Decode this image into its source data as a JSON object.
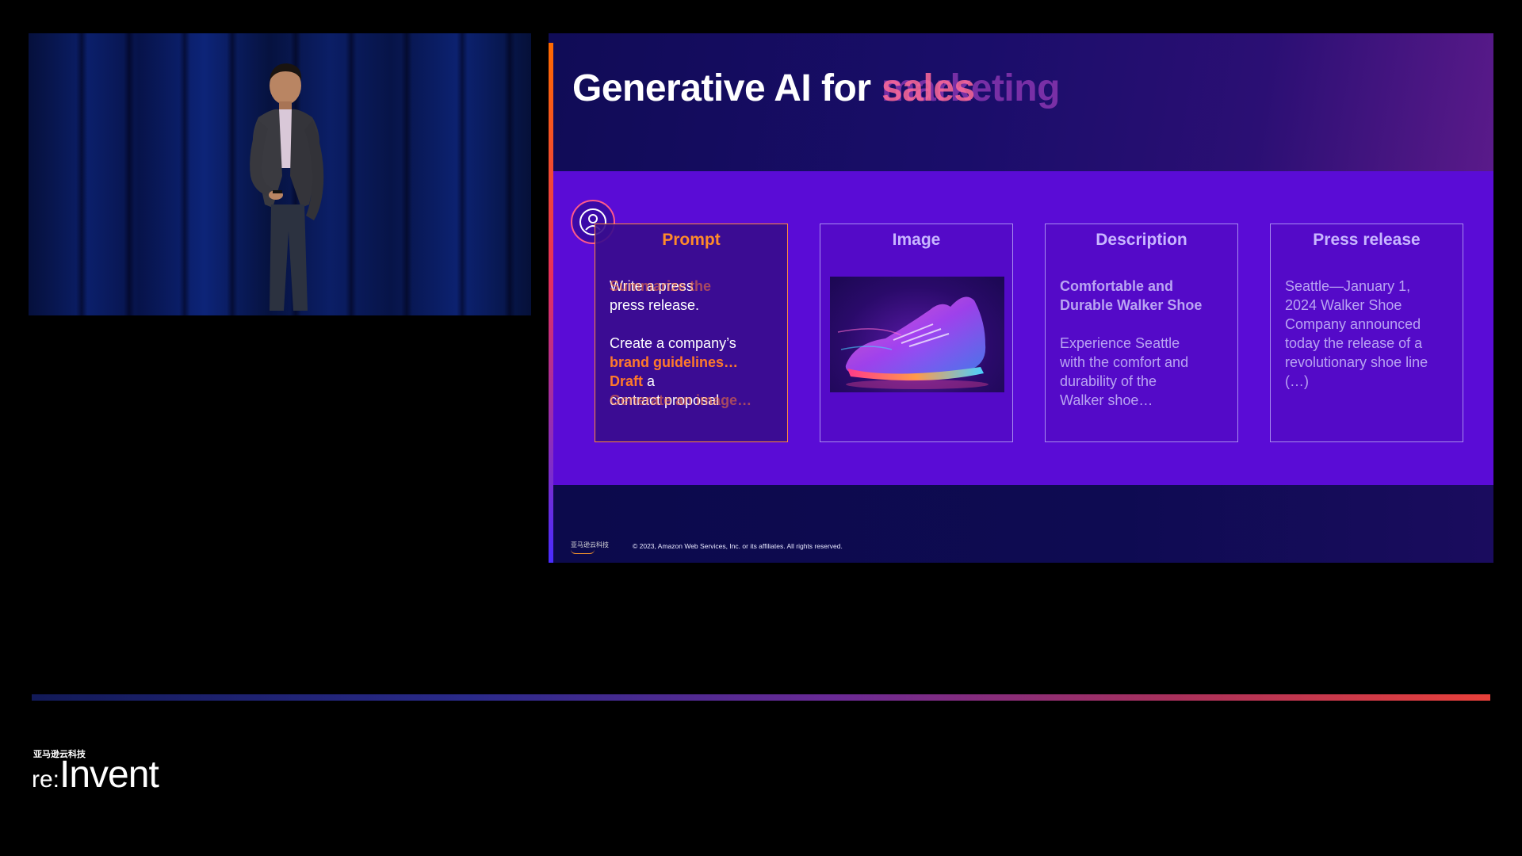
{
  "video": {
    "description_icon": "presenter-on-stage"
  },
  "slide": {
    "title_prefix": "Generative AI for ",
    "title_word_a": "sales",
    "title_word_b": "marketing",
    "cards": {
      "prompt": {
        "title": "Prompt",
        "line1_a": "Write a press",
        "line1_b": "Summarize the",
        "line2": "press release.",
        "line3_a": "Create a company’s",
        "line4": "brand guidelines…",
        "line5_orange": "Draft",
        "line5_rest": " a",
        "line6_a": "contract proposal",
        "line6_b": "Generate an image…"
      },
      "image": {
        "title": "Image",
        "image_icon": "sneaker-image"
      },
      "description": {
        "title": "Description",
        "heading": "Comfortable and Durable Walker Shoe",
        "body": "Experience Seattle with the comfort and durability of the Walker shoe…"
      },
      "press": {
        "title": "Press release",
        "body": "Seattle—January 1, 2024 Walker Shoe Company announced today the release of a revolutionary shoe line (…)"
      }
    },
    "footer": {
      "logo_text": "亚马逊云科技",
      "copyright": "© 2023, Amazon Web Services, Inc. or its affiliates. All rights reserved."
    }
  },
  "progress": {
    "fraction": 1.0
  },
  "brand": {
    "cn": "亚马逊云科技",
    "re": "re:",
    "invent": "Invent"
  },
  "colors": {
    "band": "#5a0cd6",
    "accent_orange": "#ff7a2a",
    "title_white": "#ffffff"
  }
}
